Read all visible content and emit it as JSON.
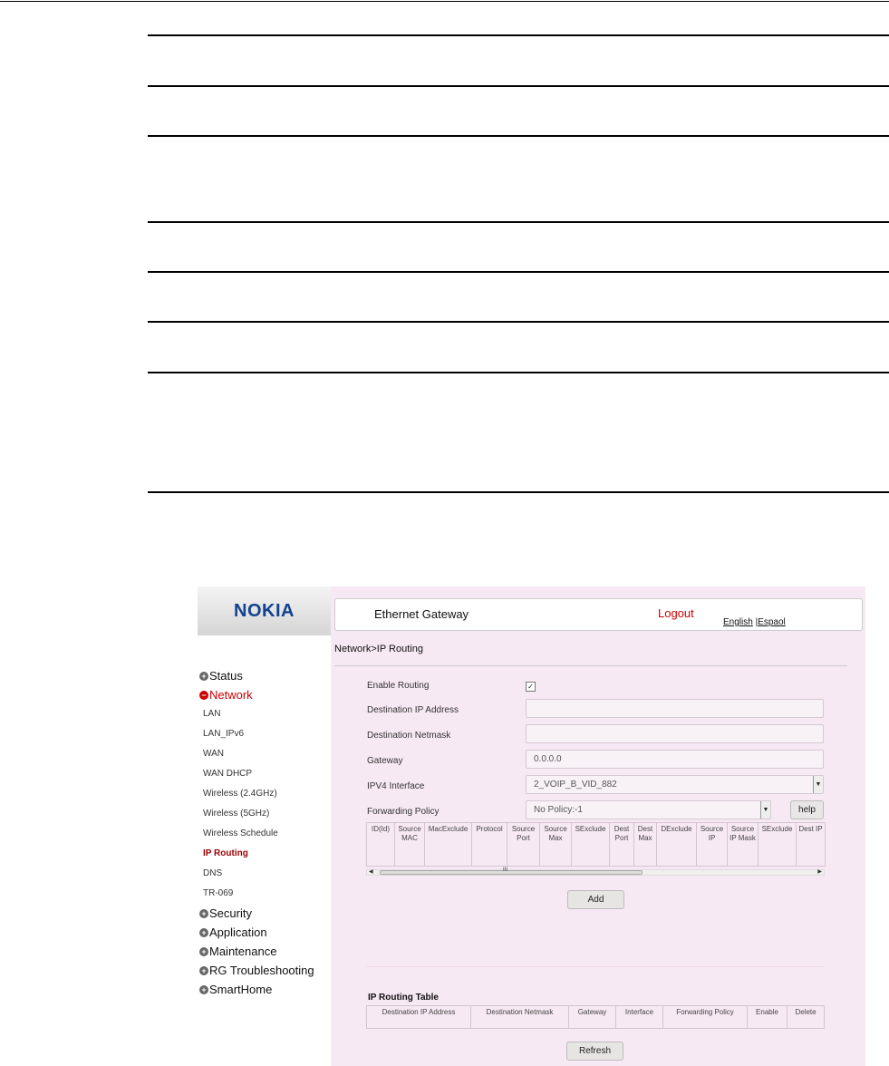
{
  "brand": {
    "logo": "NOKIA"
  },
  "header": {
    "title": "Ethernet Gateway",
    "logout": "Logout",
    "lang_english": "English",
    "lang_sep": " |",
    "lang_spanish": "Espaol"
  },
  "breadcrumb": "Network>IP Routing",
  "menu": {
    "status": "Status",
    "network": "Network",
    "network_items": [
      "LAN",
      "LAN_IPv6",
      "WAN",
      "WAN DHCP",
      "Wireless (2.4GHz)",
      "Wireless (5GHz)",
      "Wireless Schedule",
      "IP Routing",
      "DNS",
      "TR-069"
    ],
    "security": "Security",
    "application": "Application",
    "maintenance": "Maintenance",
    "rg_troubleshooting": "RG Troubleshooting",
    "smarthome": "SmartHome"
  },
  "form": {
    "enable_routing_label": "Enable Routing",
    "enable_routing_checked": true,
    "dest_ip_label": "Destination IP Address",
    "dest_ip_value": "",
    "dest_mask_label": "Destination Netmask",
    "dest_mask_value": "",
    "gateway_label": "Gateway",
    "gateway_value": "0.0.0.0",
    "ipv4_if_label": "IPV4 Interface",
    "ipv4_if_value": "2_VOIP_B_VID_882",
    "fwd_policy_label": "Forwarding Policy",
    "fwd_policy_value": "No Policy:-1",
    "help_label": "help",
    "add_label": "Add"
  },
  "policy_columns": [
    "ID(Id)",
    "Source MAC",
    "MacExclude",
    "Protocol",
    "Source Port",
    "Source Max",
    "SExclude",
    "Dest Port",
    "Dest Max",
    "DExclude",
    "Source IP",
    "Source IP Mask",
    "SExclude",
    "Dest IP"
  ],
  "scroll_mark": "III",
  "routing_table": {
    "title": "IP Routing Table",
    "columns": [
      "Destination IP Address",
      "Destination Netmask",
      "Gateway",
      "Interface",
      "Forwarding Policy",
      "Enable",
      "Delete"
    ],
    "refresh_label": "Refresh"
  }
}
